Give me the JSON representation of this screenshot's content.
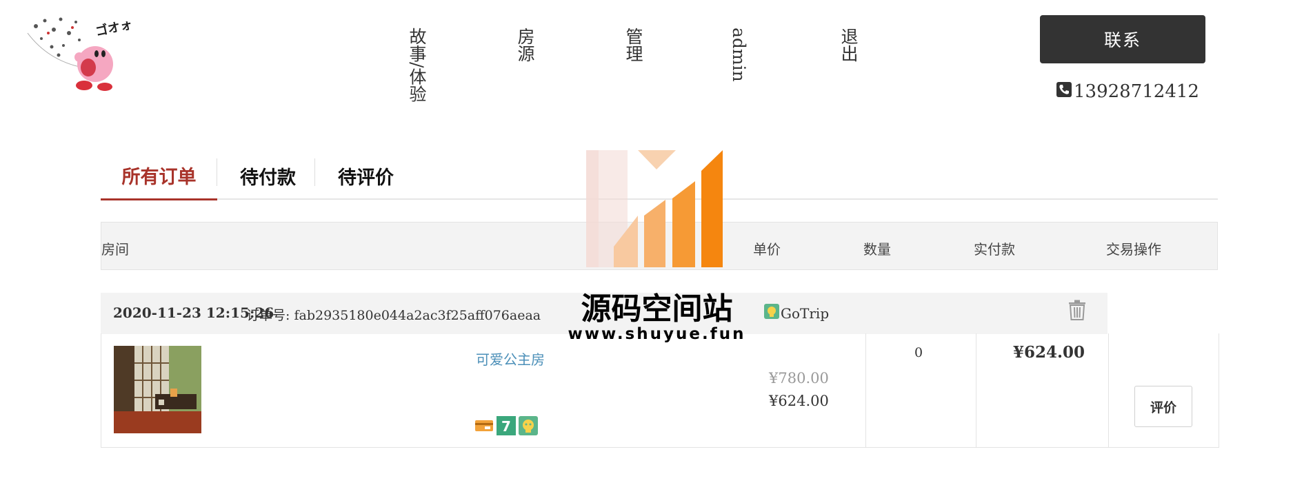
{
  "header": {
    "nav": [
      {
        "label": "故事/体验"
      },
      {
        "label": "房源"
      },
      {
        "label": "管理"
      },
      {
        "label": "admin"
      },
      {
        "label": "退出"
      }
    ],
    "contact_label": "联系",
    "phone": "13928712412",
    "phone_icon": "phone-icon"
  },
  "tabs": [
    {
      "label": "所有订单",
      "active": true
    },
    {
      "label": "待付款",
      "active": false
    },
    {
      "label": "待评价",
      "active": false
    }
  ],
  "table_header": {
    "room": "房间",
    "unit_price": "单价",
    "quantity": "数量",
    "paid": "实付款",
    "action": "交易操作"
  },
  "order": {
    "date": "2020-11-23 12:15:26",
    "order_no_label": "订单号:",
    "order_no": "fab2935180e044a2ac3f25aff076aeaa",
    "shop_name": "GoTrip",
    "room_name": "可爱公主房",
    "original_price": "¥780.00",
    "price": "¥624.00",
    "quantity": "0",
    "paid": "¥624.00",
    "review_label": "评价",
    "amenities": [
      "card-icon",
      "seven-eleven-icon",
      "pet-icon"
    ]
  },
  "watermark": {
    "title": "源码空间站",
    "url": "www.shuyue.fun"
  },
  "colors": {
    "accent": "#a8332a",
    "button_dark": "#333333",
    "link": "#4b8fb8",
    "watermark_orange": "#f5860f"
  }
}
